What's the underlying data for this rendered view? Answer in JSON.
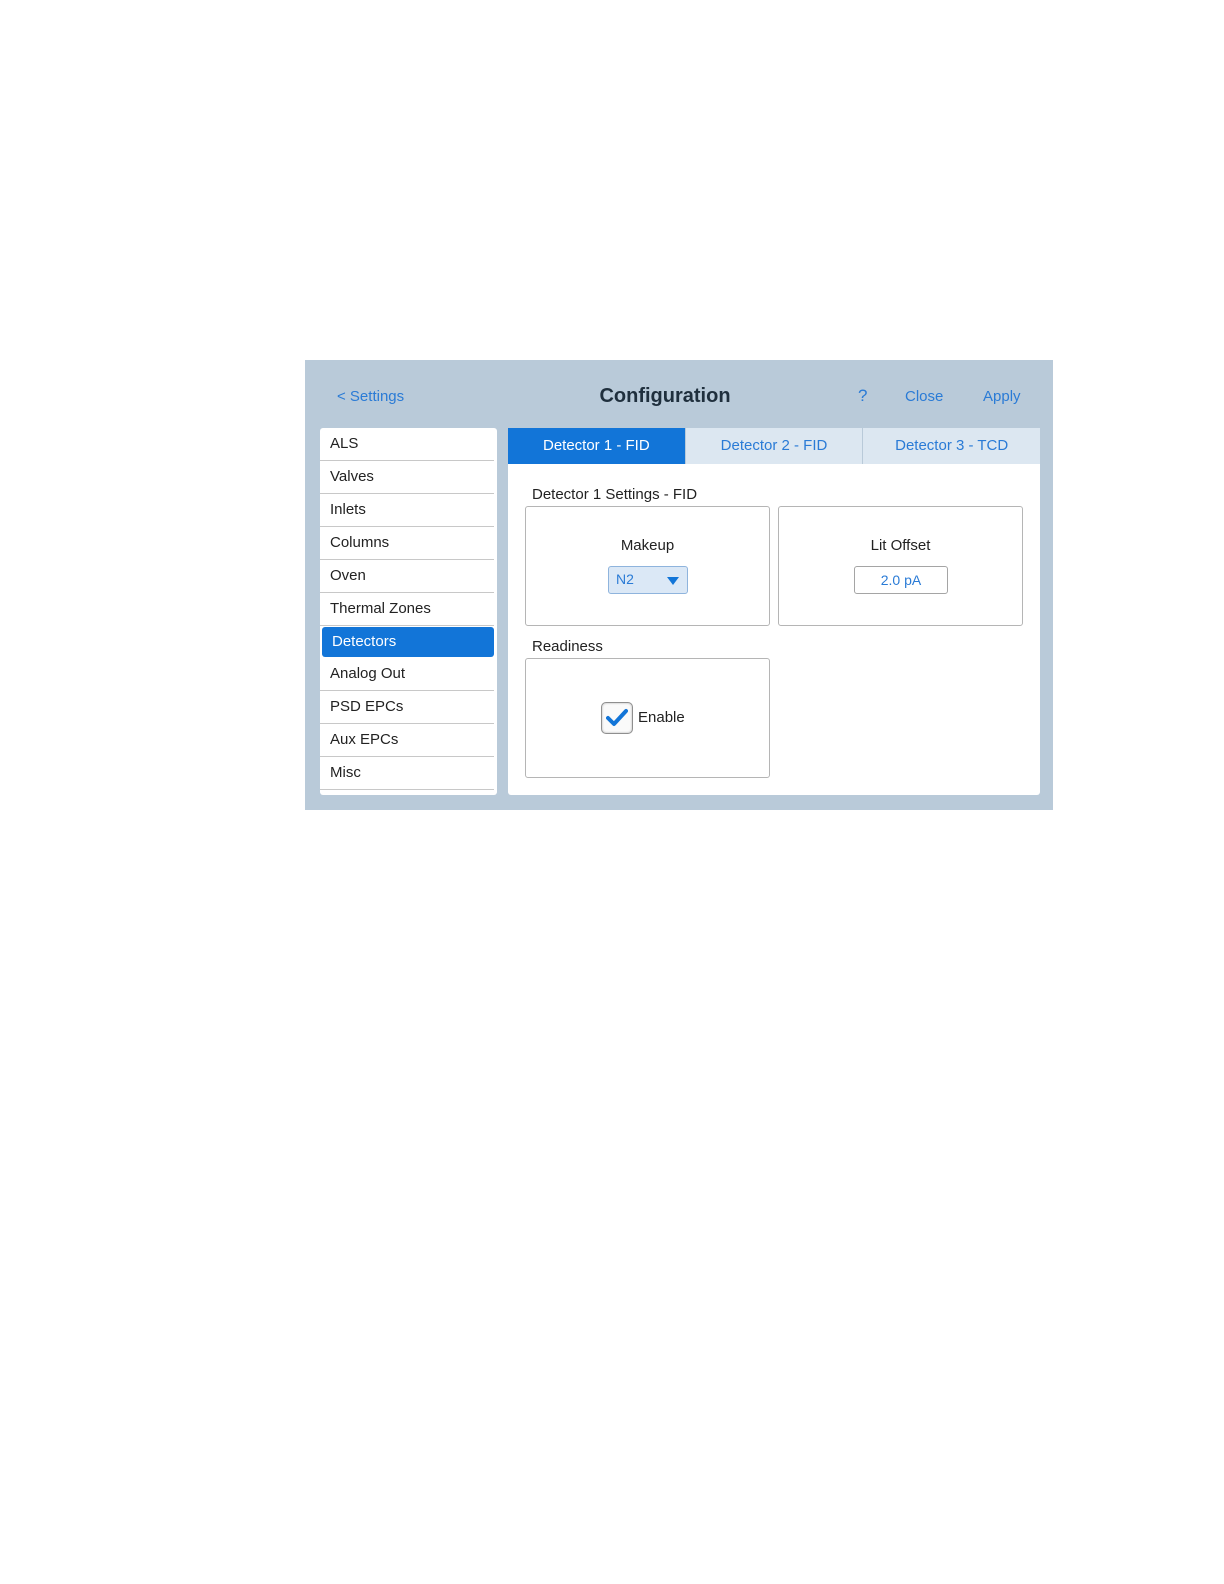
{
  "header": {
    "back_label": "< Settings",
    "title": "Configuration",
    "help_label": "?",
    "close_label": "Close",
    "apply_label": "Apply"
  },
  "sidebar": {
    "items": [
      {
        "label": "ALS"
      },
      {
        "label": "Valves"
      },
      {
        "label": "Inlets"
      },
      {
        "label": "Columns"
      },
      {
        "label": "Oven"
      },
      {
        "label": "Thermal Zones"
      },
      {
        "label": "Detectors"
      },
      {
        "label": "Analog Out"
      },
      {
        "label": "PSD EPCs"
      },
      {
        "label": "Aux EPCs"
      },
      {
        "label": "Misc"
      }
    ],
    "selected": "Detectors"
  },
  "tabs": [
    {
      "label": "Detector 1 - FID"
    },
    {
      "label": "Detector 2 - FID"
    },
    {
      "label": "Detector 3 - TCD"
    }
  ],
  "main": {
    "settings_title": "Detector 1 Settings - FID",
    "makeup": {
      "label": "Makeup",
      "value": "N2"
    },
    "lit_offset": {
      "label": "Lit Offset",
      "value": "2.0 pA"
    },
    "readiness": {
      "title": "Readiness",
      "enable_label": "Enable",
      "checked": true
    }
  },
  "colors": {
    "accent": "#1275d8",
    "link": "#2a7bd6",
    "panel_bg": "#b9cad9"
  }
}
